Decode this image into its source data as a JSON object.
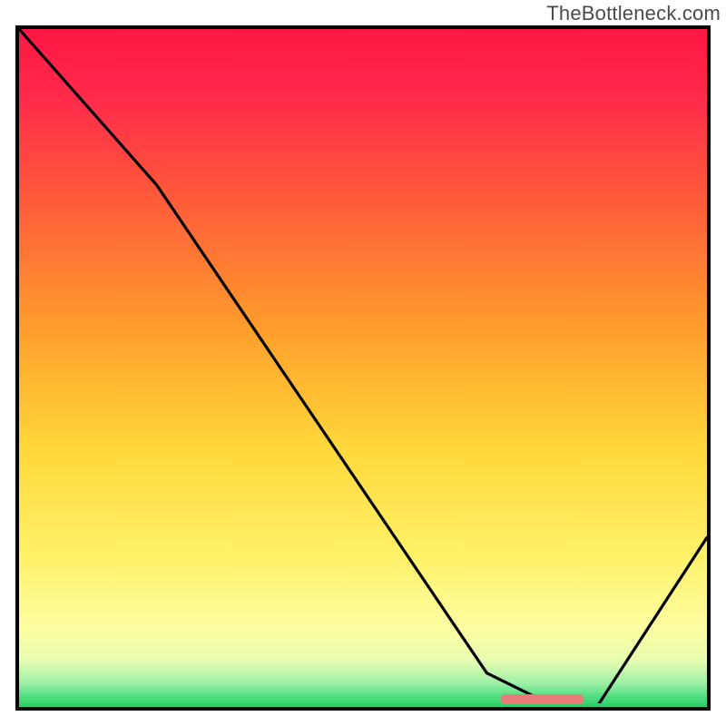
{
  "watermark": "TheBottleneck.com",
  "chart_data": {
    "type": "line",
    "title": "",
    "xlabel": "",
    "ylabel": "",
    "xlim": [
      0,
      100
    ],
    "ylim": [
      0,
      100
    ],
    "grid": false,
    "series": [
      {
        "name": "curve",
        "x": [
          0,
          20,
          68,
          78,
          84,
          100
        ],
        "values": [
          100,
          77,
          5,
          0,
          0,
          25
        ]
      }
    ],
    "marker": {
      "x_start": 70,
      "x_end": 82,
      "y": 0
    },
    "background_gradient": {
      "type": "vertical",
      "stops": [
        {
          "pos": 0.0,
          "color": "#ff1744"
        },
        {
          "pos": 0.1,
          "color": "#ff2a4a"
        },
        {
          "pos": 0.25,
          "color": "#ff5a3a"
        },
        {
          "pos": 0.45,
          "color": "#ffa02c"
        },
        {
          "pos": 0.62,
          "color": "#ffd83a"
        },
        {
          "pos": 0.78,
          "color": "#fff26a"
        },
        {
          "pos": 0.88,
          "color": "#fdfda0"
        },
        {
          "pos": 0.93,
          "color": "#e9fdb0"
        },
        {
          "pos": 0.965,
          "color": "#9ef0a8"
        },
        {
          "pos": 0.985,
          "color": "#4fdd7e"
        },
        {
          "pos": 1.0,
          "color": "#2fd06a"
        }
      ]
    }
  }
}
